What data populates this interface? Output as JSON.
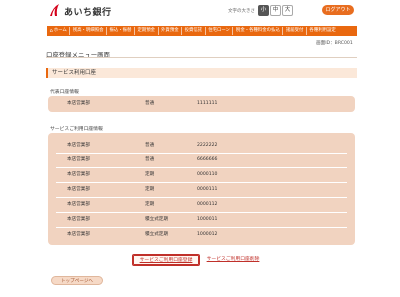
{
  "header": {
    "bank_name": "あいち銀行",
    "font_size_label": "文字の大きさ",
    "font_sizes": [
      "小",
      "中",
      "大"
    ],
    "logout_label": "ログアウト"
  },
  "nav": {
    "items": [
      "ホーム",
      "残高・明細照会",
      "振込・振替",
      "定期預金",
      "外貨預金",
      "投資信託",
      "住宅ローン",
      "税金・各種料金の払込",
      "諸届受付",
      "各種利用設定"
    ]
  },
  "screen_id": "画面ID：BRC001",
  "page_title": "口座登録メニュー画面",
  "section_title": "サービス利用口座",
  "representative": {
    "label": "代表口座情報",
    "rows": [
      {
        "branch": "本店営業部",
        "type": "普通",
        "number": "1111111"
      }
    ]
  },
  "service_accounts": {
    "label": "サービスご利用口座情報",
    "rows": [
      {
        "branch": "本店営業部",
        "type": "普通",
        "number": "2222222"
      },
      {
        "branch": "本店営業部",
        "type": "普通",
        "number": "6666666"
      },
      {
        "branch": "本店営業部",
        "type": "定期",
        "number": "0000110"
      },
      {
        "branch": "本店営業部",
        "type": "定期",
        "number": "0000111"
      },
      {
        "branch": "本店営業部",
        "type": "定期",
        "number": "0000112"
      },
      {
        "branch": "本店営業部",
        "type": "積立式定期",
        "number": "1000011"
      },
      {
        "branch": "本店営業部",
        "type": "積立式定期",
        "number": "1000012"
      }
    ]
  },
  "actions": {
    "register_label": "サービスご利用口座登録",
    "delete_label": "サービスご利用口座削除"
  },
  "top_page_label": "トップページへ",
  "colors": {
    "accent": "#e9680f",
    "panel": "#f1d3c0",
    "link": "#c0302a"
  }
}
